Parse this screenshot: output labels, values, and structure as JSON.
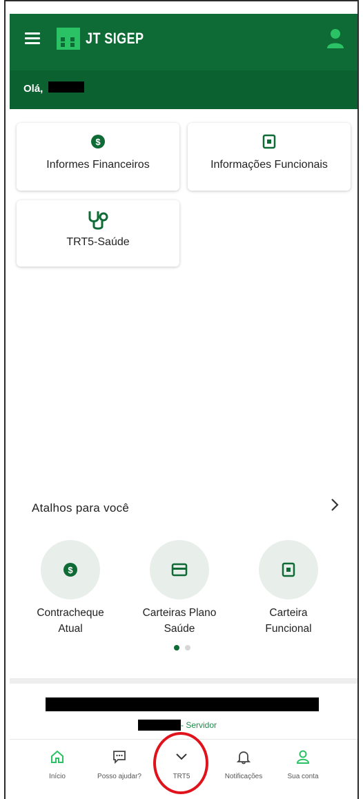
{
  "header": {
    "app_title": "JT SIGEP",
    "greeting": "Olá,",
    "menu_icon": "hamburger-menu-icon",
    "user_icon": "person-icon",
    "colors": {
      "primary": "#0e6b36",
      "accent": "#2bc265"
    }
  },
  "cards": [
    {
      "label": "Informes Financeiros",
      "icon": "dollar-circle-icon"
    },
    {
      "label": "Informações Funcionais",
      "icon": "id-badge-icon"
    },
    {
      "label": "TRT5-Saúde",
      "icon": "stethoscope-icon"
    }
  ],
  "shortcuts": {
    "title": "Atalhos para você",
    "items": [
      {
        "label_line1": "Contracheque",
        "label_line2": "Atual",
        "icon": "dollar-circle-icon"
      },
      {
        "label_line1": "Carteiras Plano",
        "label_line2": "Saúde",
        "icon": "credit-card-icon"
      },
      {
        "label_line1": "Carteira",
        "label_line2": "Funcional",
        "icon": "id-badge-icon"
      }
    ],
    "pagination": {
      "current_page": 1,
      "total_pages": 2
    }
  },
  "footer": {
    "role_suffix": "- Servidor"
  },
  "bottom_nav": [
    {
      "label": "Início",
      "icon": "home-icon",
      "active": true
    },
    {
      "label": "Posso ajudar?",
      "icon": "chat-icon",
      "active": false
    },
    {
      "label": "TRT5",
      "icon": "chevron-down-icon",
      "active": false
    },
    {
      "label": "Notificações",
      "icon": "bell-icon",
      "active": false
    },
    {
      "label": "Sua conta",
      "icon": "person-icon",
      "active": true
    }
  ]
}
